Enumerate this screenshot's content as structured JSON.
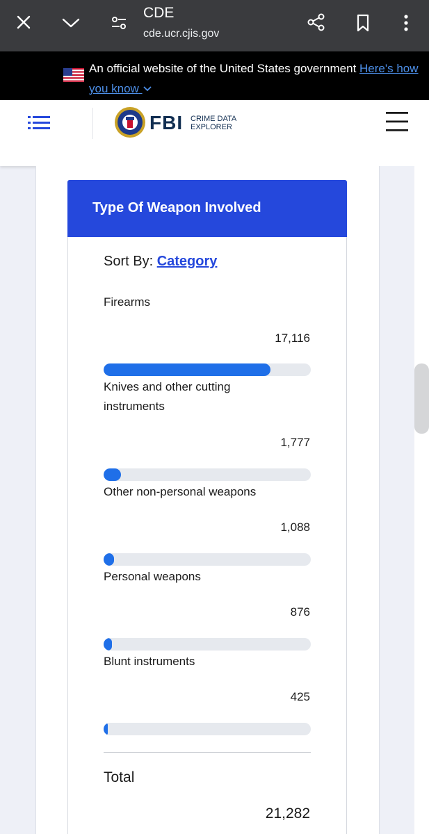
{
  "browser": {
    "title": "CDE",
    "url": "cde.ucr.cjis.gov"
  },
  "gov_banner": {
    "text": "An official website of the United States government",
    "link": "Here's how you know"
  },
  "header": {
    "logo_text": "FBI",
    "logo_sub_line1": "CRIME DATA",
    "logo_sub_line2": "EXPLORER"
  },
  "card": {
    "title": "Type Of Weapon Involved",
    "sort_prefix": "Sort By:",
    "sort_value": "Category",
    "weapons": [
      {
        "label": "Firearms",
        "value": "17,116",
        "fraction": 0.804
      },
      {
        "label": "Knives and other cutting instruments",
        "value": "1,777",
        "fraction": 0.083
      },
      {
        "label": "Other non-personal weapons",
        "value": "1,088",
        "fraction": 0.051
      },
      {
        "label": "Personal weapons",
        "value": "876",
        "fraction": 0.041
      },
      {
        "label": "Blunt instruments",
        "value": "425",
        "fraction": 0.02
      }
    ],
    "total_label": "Total",
    "total_value": "21,282"
  },
  "colors": {
    "card_header": "#2548dc",
    "bar_fill": "#1f6fe8",
    "bar_track": "#e6e9ee"
  }
}
